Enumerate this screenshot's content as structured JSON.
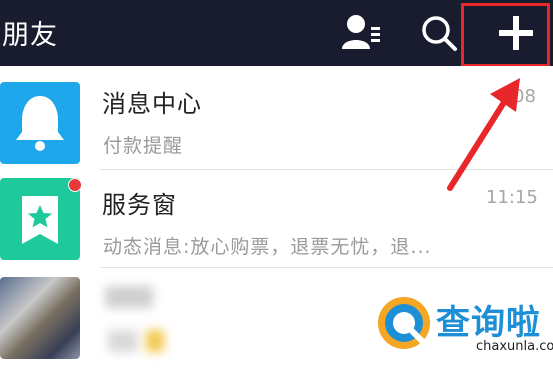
{
  "header": {
    "title": "朋友",
    "contacts_icon": "contacts-icon",
    "search_icon": "search-icon",
    "add_icon": "plus-icon"
  },
  "conversations": [
    {
      "name": "消息中心",
      "preview": "付款提醒",
      "time": "08",
      "avatar_icon": "bell-icon",
      "avatar_color": "#1ea7ea"
    },
    {
      "name": "服务窗",
      "preview": "动态消息:放心购票，退票无忧，退...",
      "time": "11:15",
      "avatar_icon": "star-bookmark-icon",
      "avatar_color": "#1ec99b",
      "unread_dot": true
    },
    {
      "name": "",
      "preview": "",
      "time": "",
      "avatar_icon": "photo-avatar",
      "blurred": true
    }
  ],
  "annotation": {
    "highlight_color": "#e8272b"
  },
  "watermark": {
    "brand": "查询啦",
    "url": "chaxunla.com"
  }
}
